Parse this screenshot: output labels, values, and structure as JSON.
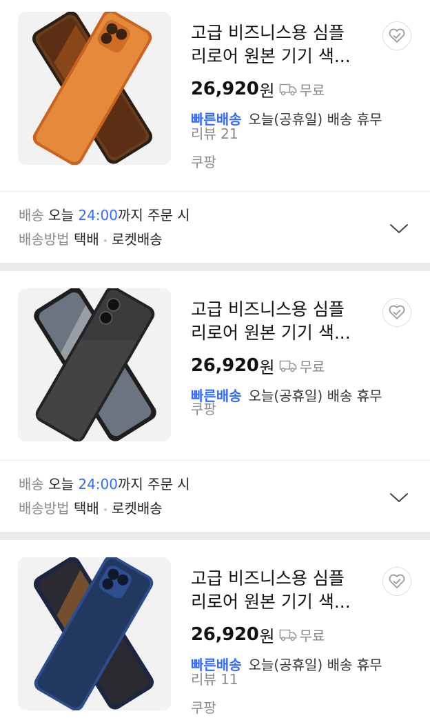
{
  "products": [
    {
      "title": "고급 비즈니스용 심플 리로어 원본 기기 색...",
      "price": "26,920",
      "currency": "원",
      "shipping_fee": "무료",
      "badge": "빠른배송",
      "arrival": "오늘(공휴일) 배송 휴무",
      "review": "리뷰 21",
      "seller": "쿠팡",
      "case_color": "#d9742a",
      "icons": {
        "wishlist": "heart-check-icon",
        "truck": "truck-icon"
      }
    },
    {
      "title": "고급 비즈니스용 심플 리로어 원본 기기 색...",
      "price": "26,920",
      "currency": "원",
      "shipping_fee": "무료",
      "badge": "빠른배송",
      "arrival": "오늘(공휴일) 배송 휴무",
      "seller": "쿠팡",
      "case_color": "#3a3a3c",
      "icons": {
        "wishlist": "heart-check-icon",
        "truck": "truck-icon"
      }
    },
    {
      "title": "고급 비즈니스용 심플 리로어 원본 기기 색...",
      "price": "26,920",
      "currency": "원",
      "shipping_fee": "무료",
      "badge": "빠른배송",
      "arrival": "오늘(공휴일) 배송 휴무",
      "review": "리뷰 11",
      "seller": "쿠팡",
      "case_color": "#27457a",
      "icons": {
        "wishlist": "heart-check-icon",
        "truck": "truck-icon"
      }
    }
  ],
  "delivery": {
    "label": "배송",
    "today": "오늘",
    "deadline": "24:00",
    "suffix": "까지 주문 시",
    "method_label": "배송방법",
    "method": "택배",
    "method_extra": "로켓배송",
    "expand_icon": "chevron-down-icon"
  },
  "colors": {
    "accent": "#346aff",
    "muted": "#8a8a8a",
    "separator": "#ebebed"
  }
}
